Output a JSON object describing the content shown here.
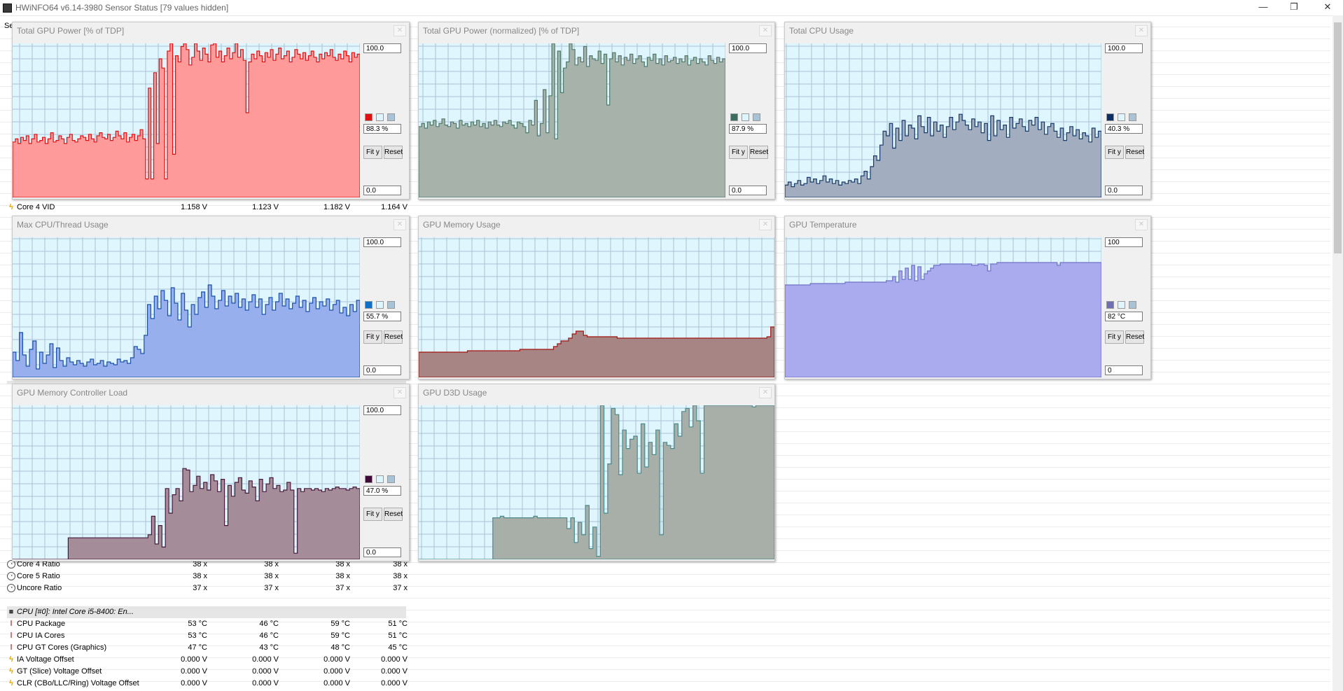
{
  "window": {
    "title": "HWiNFO64 v6.14-3980 Sensor Status [79 values hidden]",
    "minimize": "—",
    "maximize": "❐",
    "close": "✕"
  },
  "hidden_col_fragment": "Se",
  "sensor_rows": [
    {
      "icon": "bolt-icon",
      "label": "Core 4 VID",
      "values": [
        "1.158 V",
        "1.123 V",
        "1.182 V",
        "1.164 V"
      ]
    },
    {
      "icon": "clock-icon",
      "label": "Core 4 Ratio",
      "values": [
        "38 x",
        "38 x",
        "38 x",
        "38 x"
      ]
    },
    {
      "icon": "clock-icon",
      "label": "Core 5 Ratio",
      "values": [
        "38 x",
        "38 x",
        "38 x",
        "38 x"
      ]
    },
    {
      "icon": "clock-icon",
      "label": "Uncore Ratio",
      "values": [
        "37 x",
        "37 x",
        "37 x",
        "37 x"
      ]
    },
    {
      "icon": "cpu-icon",
      "label": "CPU [#0]: Intel Core i5-8400: En...",
      "values": [
        "",
        "",
        "",
        ""
      ],
      "group": true
    },
    {
      "icon": "thermometer-icon",
      "label": "CPU Package",
      "values": [
        "53 °C",
        "46 °C",
        "59 °C",
        "51 °C"
      ]
    },
    {
      "icon": "thermometer-icon",
      "label": "CPU IA Cores",
      "values": [
        "53 °C",
        "46 °C",
        "59 °C",
        "51 °C"
      ]
    },
    {
      "icon": "thermometer-icon",
      "label": "CPU GT Cores (Graphics)",
      "values": [
        "47 °C",
        "43 °C",
        "48 °C",
        "45 °C"
      ]
    },
    {
      "icon": "bolt-icon",
      "label": "IA Voltage Offset",
      "values": [
        "0.000 V",
        "0.000 V",
        "0.000 V",
        "0.000 V"
      ]
    },
    {
      "icon": "bolt-icon",
      "label": "GT (Slice) Voltage Offset",
      "values": [
        "0.000 V",
        "0.000 V",
        "0.000 V",
        "0.000 V"
      ]
    },
    {
      "icon": "bolt-icon",
      "label": "CLR (CBo/LLC/Ring) Voltage Offset",
      "values": [
        "0.000 V",
        "0.000 V",
        "0.000 V",
        "0.000 V"
      ]
    }
  ],
  "fit_label": "Fit y",
  "reset_label": "Reset",
  "grid_color": "#a9c3d6",
  "plot_bg": "#dff6ff",
  "chart_data": [
    {
      "type": "area",
      "title": "Total GPU Power [% of TDP]",
      "ymax_label": "100.0",
      "ymin_label": "0.0",
      "current": "88.3 %",
      "ylim": [
        0,
        100
      ],
      "color": "#ff9a9a",
      "line": "#e01010",
      "swatch": "#e01010",
      "values": [
        36,
        38,
        35,
        39,
        37,
        40,
        35,
        38,
        41,
        36,
        37,
        39,
        35,
        38,
        42,
        36,
        37,
        40,
        38,
        35,
        39,
        41,
        37,
        36,
        38,
        40,
        39,
        37,
        41,
        38,
        36,
        40,
        42,
        39,
        38,
        41,
        37,
        39,
        43,
        40,
        38,
        42,
        36,
        39,
        41,
        37,
        40,
        44,
        38,
        12,
        71,
        12,
        81,
        35,
        90,
        84,
        12,
        95,
        100,
        28,
        92,
        88,
        98,
        100,
        96,
        86,
        91,
        100,
        95,
        89,
        97,
        93,
        88,
        99,
        100,
        91,
        95,
        88,
        92,
        97,
        90,
        94,
        100,
        91,
        96,
        89,
        55,
        88,
        93,
        90,
        95,
        92,
        88,
        94,
        91,
        96,
        89,
        93,
        97,
        90,
        92,
        95,
        88,
        91,
        96,
        93,
        90,
        94,
        89,
        92,
        95,
        91,
        88,
        93,
        90,
        94,
        92,
        96,
        91,
        89,
        93,
        90,
        95,
        92,
        88,
        94,
        91,
        93
      ]
    },
    {
      "type": "area",
      "title": "Total GPU Power (normalized) [% of TDP]",
      "ymax_label": "100.0",
      "ymin_label": "0.0",
      "current": "87.9 %",
      "ylim": [
        0,
        100
      ],
      "color": "#a7b3aa",
      "line": "#4e7a6a",
      "swatch": "#3e6b5f",
      "values": [
        46,
        48,
        45,
        49,
        47,
        50,
        46,
        48,
        51,
        47,
        46,
        49,
        48,
        45,
        50,
        47,
        48,
        46,
        49,
        47,
        50,
        46,
        48,
        45,
        49,
        47,
        50,
        47,
        46,
        49,
        48,
        50,
        47,
        45,
        49,
        48,
        46,
        42,
        50,
        47,
        63,
        40,
        48,
        70,
        42,
        66,
        100,
        38,
        95,
        68,
        84,
        88,
        100,
        96,
        86,
        91,
        88,
        98,
        85,
        92,
        90,
        89,
        95,
        87,
        93,
        60,
        90,
        94,
        88,
        92,
        86,
        91,
        89,
        93,
        87,
        90,
        92,
        88,
        85,
        91,
        89,
        93,
        87,
        90,
        86,
        92,
        88,
        89,
        91,
        87,
        90,
        88,
        92,
        86,
        89,
        91,
        87,
        90,
        88,
        86,
        92,
        89,
        87,
        91,
        88,
        90
      ]
    },
    {
      "type": "area",
      "title": "Total CPU Usage",
      "ymax_label": "100.0",
      "ymin_label": "0.0",
      "current": "40.3 %",
      "ylim": [
        0,
        100
      ],
      "color": "#a3adc0",
      "line": "#173a6a",
      "swatch": "#0b2e66",
      "values": [
        8,
        10,
        7,
        9,
        11,
        8,
        9,
        13,
        10,
        12,
        9,
        11,
        14,
        10,
        12,
        9,
        11,
        8,
        10,
        9,
        11,
        10,
        12,
        9,
        14,
        17,
        12,
        20,
        27,
        24,
        34,
        43,
        40,
        48,
        32,
        45,
        37,
        50,
        40,
        47,
        45,
        38,
        53,
        46,
        42,
        52,
        40,
        49,
        43,
        47,
        39,
        46,
        52,
        44,
        49,
        54,
        50,
        47,
        44,
        51,
        46,
        49,
        42,
        48,
        37,
        53,
        40,
        50,
        44,
        47,
        39,
        52,
        45,
        48,
        51,
        46,
        43,
        50,
        47,
        52,
        44,
        49,
        41,
        46,
        48,
        43,
        39,
        45,
        37,
        42,
        46,
        40,
        44,
        38,
        42,
        40,
        36,
        45,
        39,
        43
      ]
    },
    {
      "type": "area",
      "title": "Max CPU/Thread Usage",
      "ymax_label": "100.0",
      "ymin_label": "0.0",
      "current": "55.7 %",
      "ylim": [
        0,
        100
      ],
      "color": "#98afee",
      "line": "#1b4fa8",
      "swatch": "#1070c8",
      "values": [
        18,
        12,
        32,
        16,
        8,
        20,
        26,
        6,
        18,
        10,
        16,
        24,
        7,
        21,
        12,
        8,
        14,
        11,
        9,
        12,
        10,
        8,
        11,
        13,
        9,
        10,
        12,
        8,
        11,
        10,
        9,
        13,
        11,
        12,
        10,
        14,
        22,
        20,
        17,
        30,
        52,
        42,
        58,
        49,
        62,
        55,
        44,
        64,
        53,
        41,
        60,
        48,
        36,
        52,
        45,
        57,
        61,
        50,
        66,
        58,
        49,
        55,
        62,
        51,
        58,
        53,
        60,
        50,
        56,
        48,
        54,
        59,
        50,
        56,
        45,
        52,
        57,
        48,
        54,
        60,
        51,
        56,
        49,
        53,
        58,
        50,
        55,
        47,
        53,
        57,
        49,
        54,
        51,
        56,
        48,
        52,
        55,
        46,
        50,
        44,
        52,
        47,
        55
      ]
    },
    {
      "type": "area",
      "title": "GPU Memory Usage",
      "ymax_label": "",
      "ymin_label": "",
      "current": "",
      "ylim": [
        0,
        100
      ],
      "color": "#a88585",
      "line": "#a3150f",
      "swatch": "",
      "values": [
        18,
        18,
        18,
        18,
        18,
        18,
        18,
        18,
        18,
        18,
        18,
        18,
        18,
        19,
        19,
        19,
        19,
        19,
        19,
        19,
        19,
        19,
        19,
        19,
        19,
        19,
        19,
        20,
        20,
        20,
        20,
        20,
        20,
        20,
        20,
        20,
        22,
        24,
        26,
        26,
        28,
        31,
        33,
        33,
        30,
        29,
        29,
        29,
        29,
        29,
        29,
        29,
        29,
        28,
        28,
        28,
        28,
        28,
        28,
        28,
        28,
        28,
        28,
        28,
        28,
        28,
        28,
        28,
        28,
        28,
        28,
        28,
        28,
        28,
        28,
        28,
        28,
        28,
        28,
        28,
        28,
        28,
        28,
        28,
        28,
        28,
        28,
        28,
        28,
        28,
        28,
        28,
        28,
        29,
        36
      ]
    },
    {
      "type": "area",
      "title": "GPU Temperature",
      "ymax_label": "100",
      "ymin_label": "0",
      "current": "82 °C",
      "ylim": [
        0,
        100
      ],
      "color": "#aaaaee",
      "line": "#7272c8",
      "swatch": "#6f6fb5",
      "values": [
        66,
        66,
        66,
        66,
        66,
        66,
        66,
        66,
        67,
        67,
        67,
        67,
        67,
        67,
        67,
        67,
        67,
        67,
        67,
        68,
        68,
        68,
        68,
        68,
        68,
        68,
        68,
        68,
        68,
        68,
        68,
        68,
        69,
        69,
        72,
        68,
        76,
        70,
        78,
        70,
        80,
        69,
        79,
        70,
        74,
        76,
        78,
        80,
        80,
        81,
        81,
        81,
        81,
        81,
        81,
        81,
        81,
        81,
        81,
        80,
        80,
        81,
        81,
        80,
        76,
        81,
        81,
        82,
        82,
        82,
        82,
        82,
        82,
        82,
        82,
        82,
        82,
        82,
        82,
        82,
        82,
        82,
        82,
        82,
        82,
        82,
        80,
        82,
        82,
        82,
        82,
        82,
        82,
        82,
        82,
        82,
        82,
        82,
        82,
        82
      ]
    },
    {
      "type": "area",
      "title": "GPU Memory Controller Load",
      "ymax_label": "100.0",
      "ymin_label": "0.0",
      "current": "47.0 %",
      "ylim": [
        0,
        100
      ],
      "color": "#a48d98",
      "line": "#4a1a3c",
      "swatch": "#3d0a35",
      "values": [
        0,
        0,
        0,
        0,
        0,
        0,
        0,
        0,
        0,
        0,
        0,
        0,
        0,
        0,
        0,
        0,
        14,
        14,
        14,
        14,
        14,
        14,
        14,
        14,
        14,
        14,
        14,
        14,
        14,
        14,
        14,
        14,
        14,
        14,
        14,
        14,
        14,
        14,
        14,
        16,
        28,
        10,
        22,
        8,
        46,
        30,
        42,
        46,
        38,
        59,
        58,
        44,
        48,
        54,
        46,
        50,
        45,
        55,
        51,
        44,
        52,
        22,
        48,
        41,
        50,
        53,
        45,
        43,
        51,
        47,
        38,
        52,
        44,
        49,
        53,
        46,
        48,
        44,
        45,
        50,
        45,
        4,
        46,
        44,
        46,
        46,
        45,
        46,
        45,
        44,
        46,
        45,
        46,
        47,
        46,
        46,
        45,
        46,
        47,
        46
      ]
    },
    {
      "type": "area",
      "title": "GPU D3D Usage",
      "ymax_label": "",
      "ymin_label": "",
      "current": "",
      "ylim": [
        0,
        100
      ],
      "color": "#a8afa9",
      "line": "#4a8a8a",
      "swatch": "",
      "values": [
        0,
        0,
        0,
        0,
        0,
        0,
        0,
        0,
        0,
        0,
        0,
        0,
        0,
        0,
        0,
        0,
        0,
        0,
        0,
        0,
        27,
        27,
        28,
        27,
        27,
        27,
        27,
        27,
        27,
        27,
        27,
        28,
        27,
        27,
        27,
        27,
        27,
        27,
        27,
        27,
        20,
        27,
        11,
        24,
        16,
        35,
        7,
        21,
        2,
        100,
        30,
        62,
        98,
        94,
        55,
        84,
        72,
        78,
        80,
        56,
        88,
        60,
        76,
        68,
        84,
        16,
        76,
        74,
        72,
        88,
        80,
        96,
        98,
        86,
        100,
        90,
        56,
        100,
        100,
        100,
        100,
        100,
        100,
        100,
        100,
        100,
        100,
        100,
        100,
        100,
        99,
        100,
        100,
        100,
        100,
        100
      ]
    }
  ]
}
